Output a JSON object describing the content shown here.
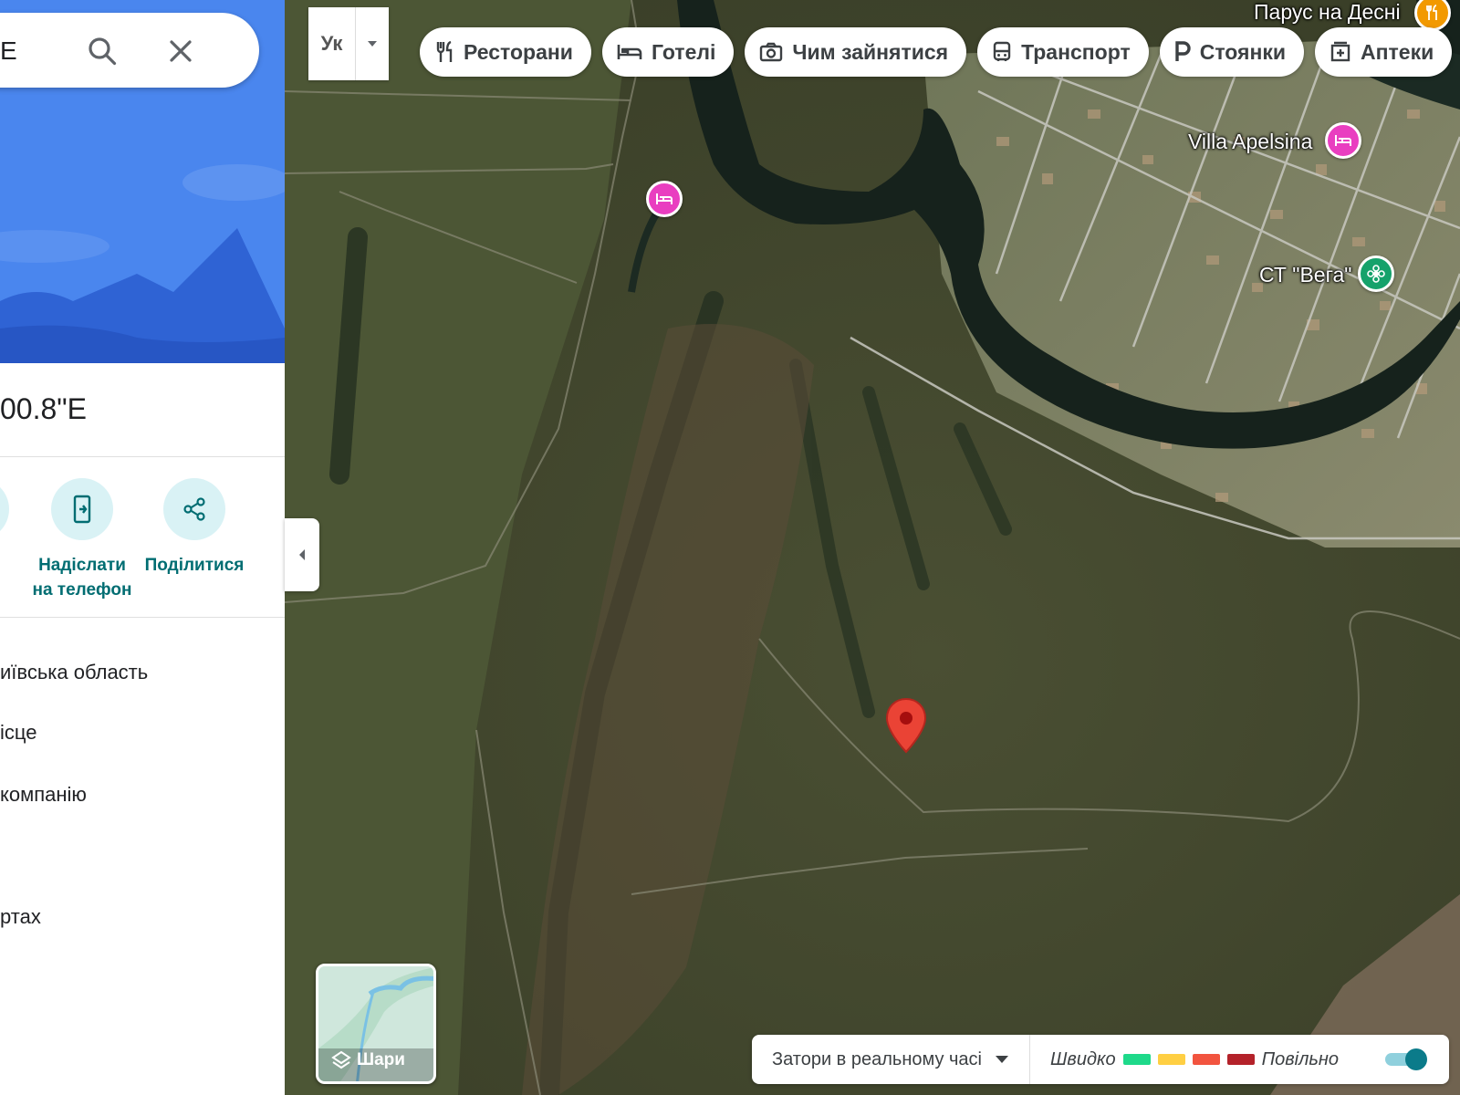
{
  "search": {
    "query": "E"
  },
  "place": {
    "coordinates_partial": "00.8\"E"
  },
  "actions": [
    {
      "label": "у",
      "icon": "partial-icon"
    },
    {
      "label": "Надіслати на телефон",
      "icon": "send-to-phone-icon"
    },
    {
      "label": "Поділитися",
      "icon": "share-icon"
    }
  ],
  "menu": [
    {
      "label": "иївська область"
    },
    {
      "label": "ісце"
    },
    {
      "label": "компанію"
    },
    {
      "label": "ртах"
    }
  ],
  "map": {
    "language_code": "Ук",
    "chips": [
      {
        "label": "Ресторани",
        "icon": "fork-knife-icon"
      },
      {
        "label": "Готелі",
        "icon": "bed-icon"
      },
      {
        "label": "Чим зайнятися",
        "icon": "camera-icon"
      },
      {
        "label": "Транспорт",
        "icon": "bus-icon"
      },
      {
        "label": "Стоянки",
        "icon": "parking-icon"
      },
      {
        "label": "Аптеки",
        "icon": "pharmacy-icon"
      }
    ],
    "pois": [
      {
        "label": "Парус на Десні",
        "type": "restaurant",
        "color": "#f29900"
      },
      {
        "label": "Villa Apelsina",
        "type": "hotel",
        "color": "#e93ec0"
      },
      {
        "label": "СТ \"Вега\"",
        "type": "park",
        "color": "#15a26b"
      },
      {
        "label": "",
        "type": "hotel",
        "color": "#e93ec0"
      }
    ],
    "pin_color": "#ea4335",
    "layers_label": "Шари",
    "traffic": {
      "dropdown_label": "Затори в реальному часі",
      "fast_label": "Швидко",
      "slow_label": "Повільно",
      "colors": [
        "#1ed98a",
        "#ffcf43",
        "#f2543f",
        "#b4222a"
      ],
      "enabled": true
    }
  }
}
